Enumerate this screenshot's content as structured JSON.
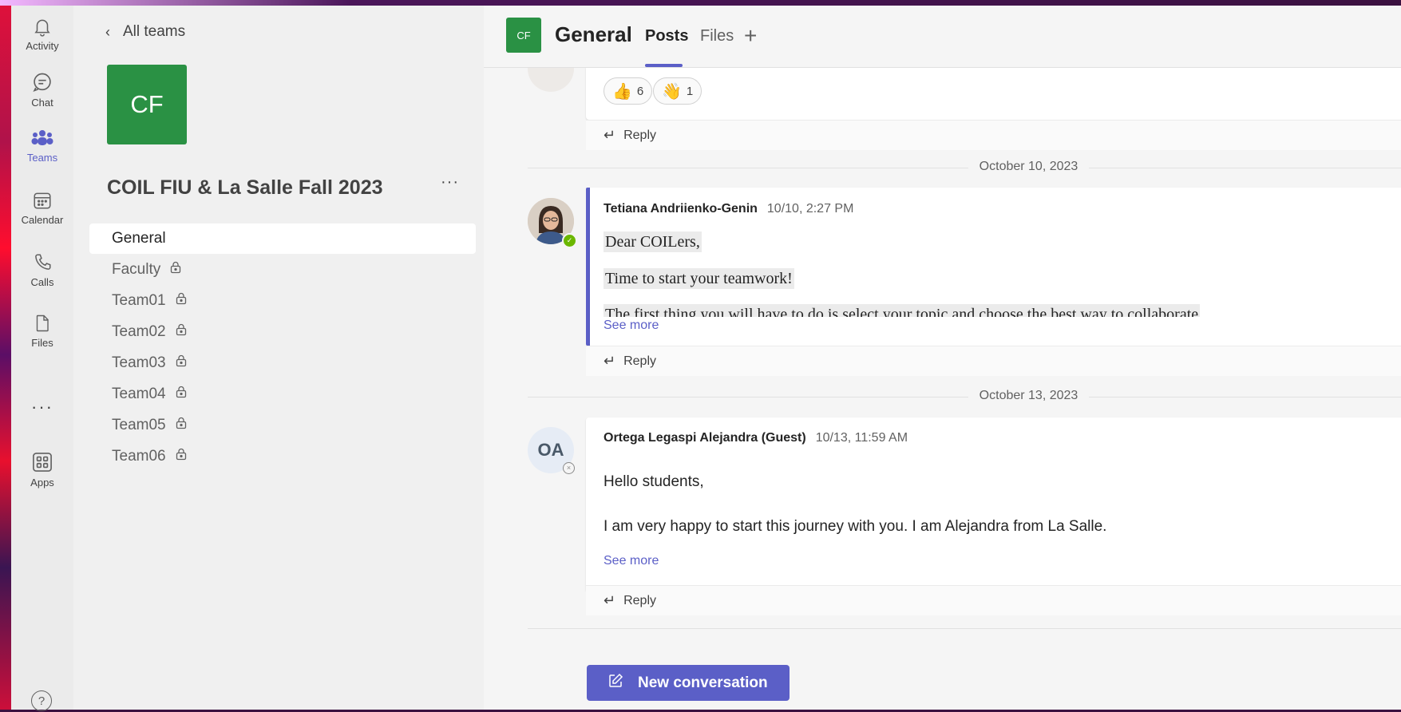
{
  "rail": {
    "activity": "Activity",
    "chat": "Chat",
    "teams": "Teams",
    "calendar": "Calendar",
    "calls": "Calls",
    "files": "Files",
    "more": "···",
    "apps": "Apps",
    "help": "?"
  },
  "team_panel": {
    "back_label": "All teams",
    "team_initials": "CF",
    "team_name": "COIL FIU & La Salle Fall 2023",
    "more": "···",
    "channels": [
      "General",
      "Faculty",
      "Team01",
      "Team02",
      "Team03",
      "Team04",
      "Team05",
      "Team06"
    ],
    "active_channel": "General"
  },
  "header": {
    "channel_initials": "CF",
    "channel_name": "General",
    "tabs": [
      "Posts",
      "Files"
    ],
    "active_tab": "Posts",
    "add_tab": "+"
  },
  "feed": {
    "reactions": [
      {
        "emoji": "👍",
        "count": "6"
      },
      {
        "emoji": "👋",
        "count": "1"
      }
    ],
    "reply_label": "Reply",
    "see_more": "See more",
    "posts": [
      {
        "date": "October 10, 2023",
        "author": "Tetiana Andriienko-Genin",
        "time": "10/10, 2:27 PM",
        "lines": [
          "Dear COILers,",
          "Time to start your teamwork!",
          "The first thing you will have to do is select your topic and choose the best way to collaborate"
        ]
      },
      {
        "date": "October 13, 2023",
        "author": "Ortega Legaspi Alejandra (Guest)",
        "initials": "OA",
        "time": "10/13, 11:59 AM",
        "lines": [
          "Hello students,",
          "I am very happy to start this journey with you. I am Alejandra from La Salle."
        ]
      }
    ],
    "new_conversation": "New conversation"
  },
  "colors": {
    "accent": "#5b5fc7",
    "team_green": "#2a9144",
    "available": "#6bb700"
  }
}
